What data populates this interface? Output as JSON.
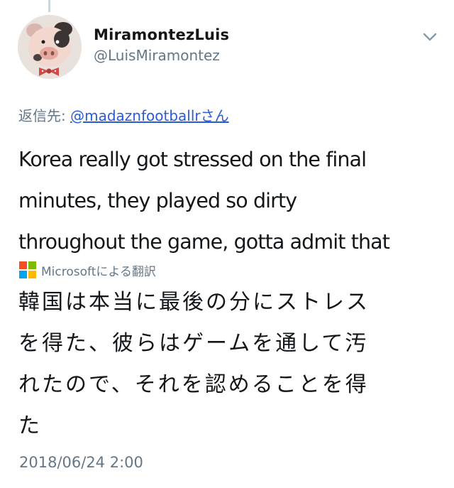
{
  "tweet": {
    "display_name": "MiramontezLuis",
    "handle": "@LuisMiramontez",
    "reply_prefix": "返信先: ",
    "reply_to": "@madaznfootballrさん",
    "text_lines": [
      "Korea really got stressed on the final",
      "minutes, they played so dirty",
      "throughout the game, gotta admit that"
    ],
    "translation_label": "Microsoftによる翻訳",
    "translation_lines": [
      "韓国は本当に最後の分にストレス",
      "を得た、彼らはゲームを通して汚",
      "れたので、それを認めることを得",
      "た"
    ],
    "timestamp": "2018/06/24 2:00"
  },
  "icons": {
    "avatar": "pig-avatar",
    "menu": "chevron-down-icon",
    "translator": "microsoft-logo-icon"
  },
  "colors": {
    "text": "#14171a",
    "secondary": "#657786",
    "link": "#2b5cd6",
    "ms_red": "#f25022",
    "ms_green": "#7fba00",
    "ms_blue": "#00a4ef",
    "ms_yellow": "#ffb900"
  }
}
